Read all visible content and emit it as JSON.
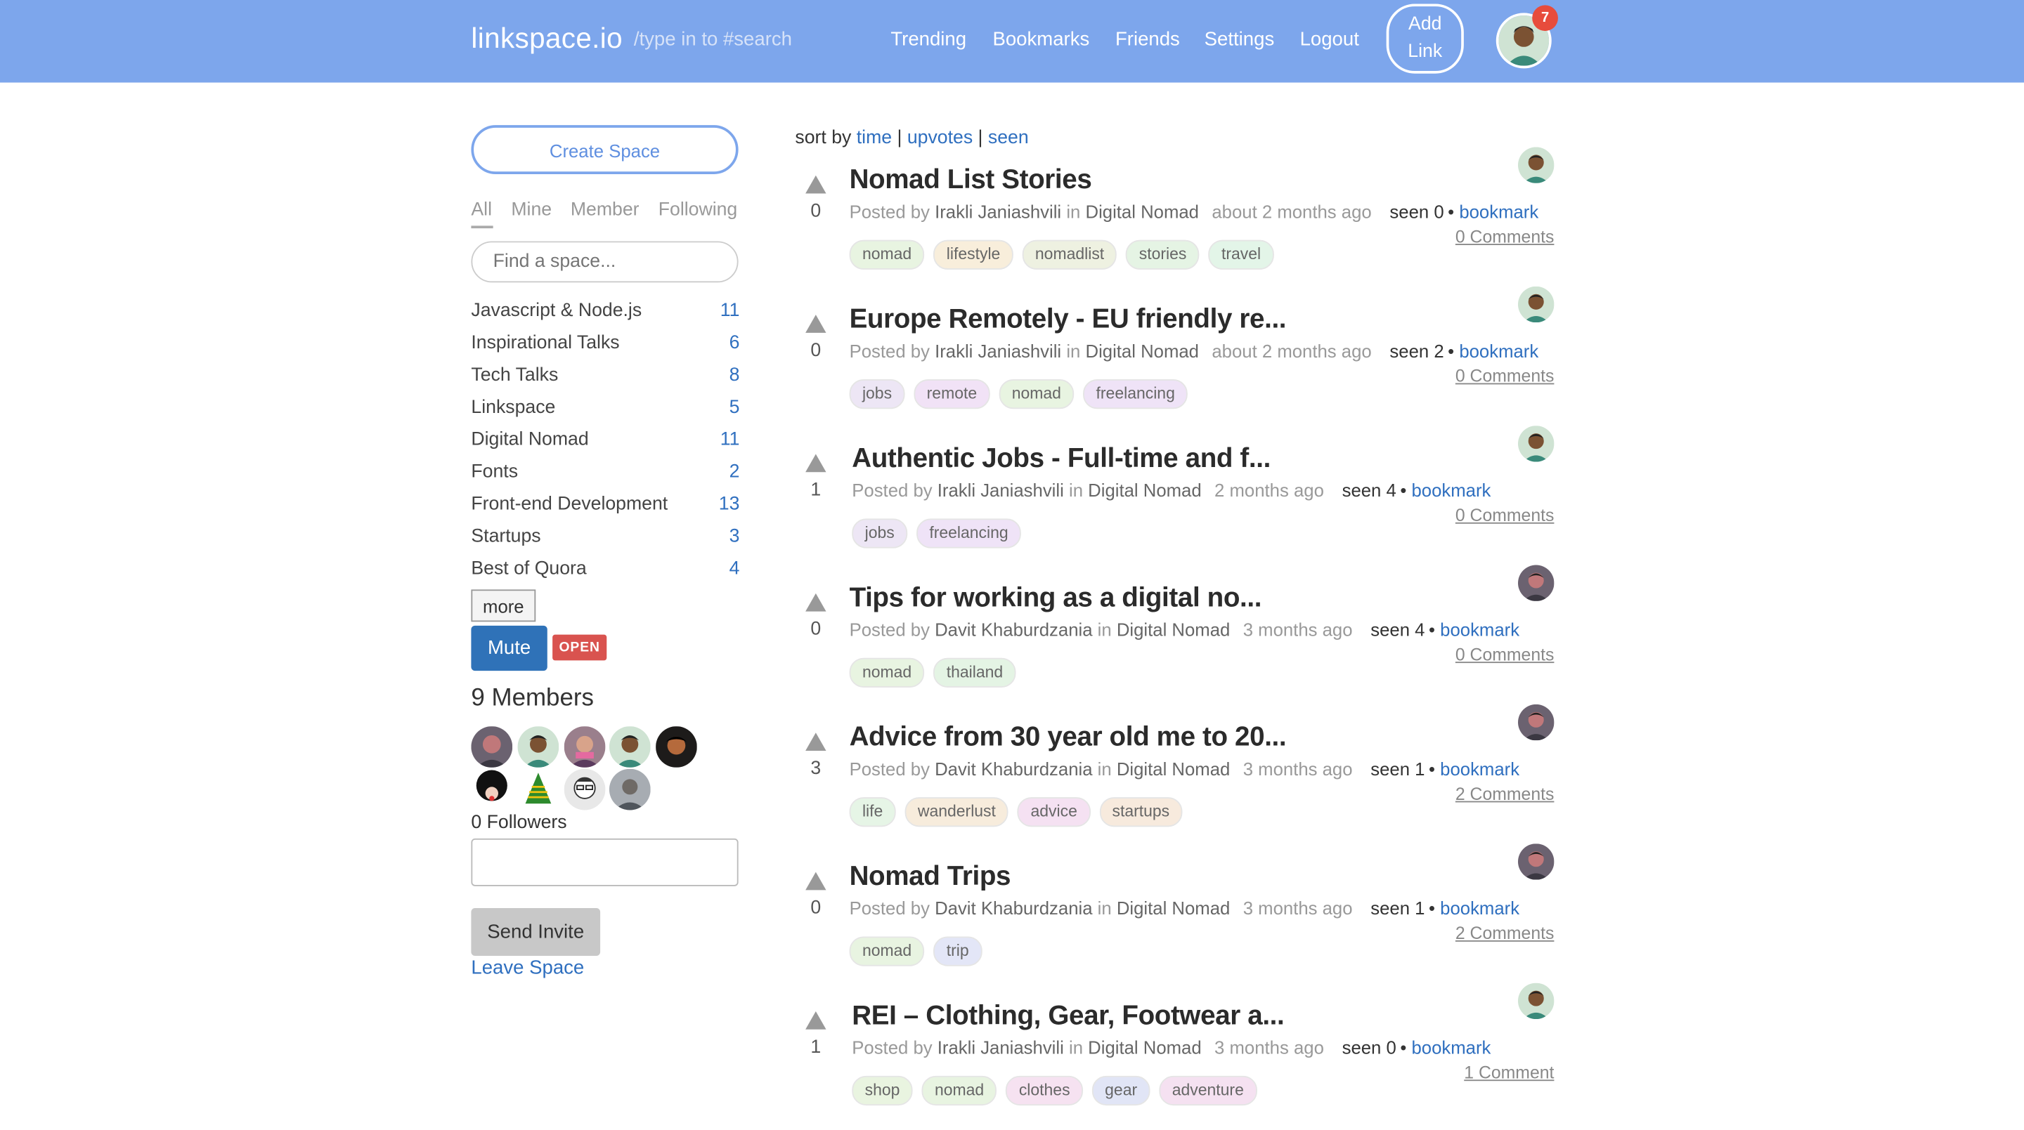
{
  "header": {
    "brand": "linkspace.io",
    "search_placeholder": "/type in to #search",
    "nav": [
      "Trending",
      "Bookmarks",
      "Friends",
      "Settings",
      "Logout"
    ],
    "add_link": "Add Link",
    "notifications": "7"
  },
  "sidebar": {
    "create_space": "Create Space",
    "filters": [
      "All",
      "Mine",
      "Member",
      "Following"
    ],
    "find_placeholder": "Find a space...",
    "spaces": [
      {
        "name": "Javascript & Node.js",
        "count": "11"
      },
      {
        "name": "Inspirational Talks",
        "count": "6"
      },
      {
        "name": "Tech Talks",
        "count": "8"
      },
      {
        "name": "Linkspace",
        "count": "5"
      },
      {
        "name": "Digital Nomad",
        "count": "11"
      },
      {
        "name": "Fonts",
        "count": "2"
      },
      {
        "name": "Front-end Development",
        "count": "13"
      },
      {
        "name": "Startups",
        "count": "3"
      },
      {
        "name": "Best of Quora",
        "count": "4"
      }
    ],
    "more": "more",
    "mute": "Mute",
    "open_badge": "OPEN",
    "members_title": "9 Members",
    "followers": "0 Followers",
    "send_invite": "Send Invite",
    "leave_space": "Leave Space"
  },
  "sort": {
    "prefix": "sort by",
    "time": "time",
    "upvotes": "upvotes",
    "seen": "seen",
    "sep": "|"
  },
  "posts": [
    {
      "votes": "0",
      "title": "Nomad List Stories",
      "posted_by": "Posted by",
      "author": "Irakli Janiashvili",
      "in": "in",
      "space": "Digital Nomad",
      "ago": "about 2 months ago",
      "seen": "seen 0",
      "bookmark": "bookmark",
      "comments": "0 Comments",
      "tags": [
        "nomad",
        "lifestyle",
        "nomadlist",
        "stories",
        "travel"
      ]
    },
    {
      "votes": "0",
      "title": "Europe Remotely - EU friendly re...",
      "posted_by": "Posted by",
      "author": "Irakli Janiashvili",
      "in": "in",
      "space": "Digital Nomad",
      "ago": "about 2 months ago",
      "seen": "seen 2",
      "bookmark": "bookmark",
      "comments": "0 Comments",
      "tags": [
        "jobs",
        "remote",
        "nomad",
        "freelancing"
      ]
    },
    {
      "votes": "1",
      "title": "Authentic Jobs - Full-time and f...",
      "posted_by": "Posted by",
      "author": "Irakli Janiashvili",
      "in": "in",
      "space": "Digital Nomad",
      "ago": "2 months ago",
      "seen": "seen 4",
      "bookmark": "bookmark",
      "comments": "0 Comments",
      "tags": [
        "jobs",
        "freelancing"
      ]
    },
    {
      "votes": "0",
      "title": "Tips for working as a digital no...",
      "posted_by": "Posted by",
      "author": "Davit Khaburdzania",
      "in": "in",
      "space": "Digital Nomad",
      "ago": "3 months ago",
      "seen": "seen 4",
      "bookmark": "bookmark",
      "comments": "0 Comments",
      "tags": [
        "nomad",
        "thailand"
      ]
    },
    {
      "votes": "3",
      "title": "Advice from 30 year old me to 20...",
      "posted_by": "Posted by",
      "author": "Davit Khaburdzania",
      "in": "in",
      "space": "Digital Nomad",
      "ago": "3 months ago",
      "seen": "seen 1",
      "bookmark": "bookmark",
      "comments": "2 Comments",
      "tags": [
        "life",
        "wanderlust",
        "advice",
        "startups"
      ]
    },
    {
      "votes": "0",
      "title": "Nomad Trips",
      "posted_by": "Posted by",
      "author": "Davit Khaburdzania",
      "in": "in",
      "space": "Digital Nomad",
      "ago": "3 months ago",
      "seen": "seen 1",
      "bookmark": "bookmark",
      "comments": "2 Comments",
      "tags": [
        "nomad",
        "trip"
      ]
    },
    {
      "votes": "1",
      "title": "REI – Clothing, Gear, Footwear a...",
      "posted_by": "Posted by",
      "author": "Irakli Janiashvili",
      "in": "in",
      "space": "Digital Nomad",
      "ago": "3 months ago",
      "seen": "seen 0",
      "bookmark": "bookmark",
      "comments": "1 Comment",
      "tags": [
        "shop",
        "nomad",
        "clothes",
        "gear",
        "adventure"
      ]
    }
  ],
  "tag_colors": {
    "nomad": "#e8f4e1",
    "lifestyle": "#f8eedb",
    "nomadlist": "#eef1e1",
    "stories": "#e5f4e4",
    "travel": "#e3f5e8",
    "jobs": "#ede6f5",
    "remote": "#f1e2f6",
    "freelancing": "#efe3f7",
    "thailand": "#e4f4e4",
    "life": "#e6f5e6",
    "wanderlust": "#f7ecdc",
    "advice": "#f5e1f2",
    "startups": "#f7eadd",
    "trip": "#e3e6f7",
    "shop": "#e9f4e0",
    "clothes": "#f6e2f1",
    "gear": "#e1e5f6",
    "adventure": "#f5e1f1"
  },
  "colors": {
    "header": "#7da6ec",
    "link": "#2f6fbf",
    "badge": "#d9534f",
    "mute": "#2f72b8"
  }
}
